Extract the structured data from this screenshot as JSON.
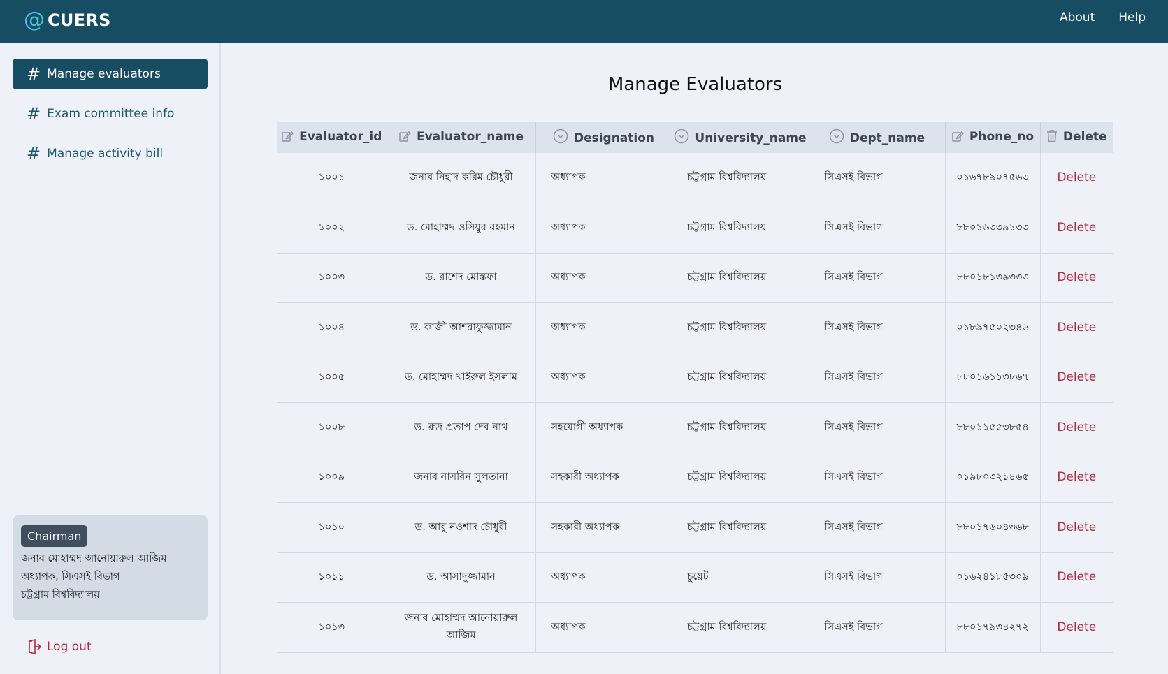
{
  "app": {
    "logo_symbol": "@",
    "name": "CUERS"
  },
  "topnav": {
    "about": "About",
    "help": "Help"
  },
  "sidebar": {
    "items": [
      {
        "label": "Manage evaluators",
        "active": true
      },
      {
        "label": "Exam committee info",
        "active": false
      },
      {
        "label": "Manage activity bill",
        "active": false
      }
    ]
  },
  "user": {
    "role": "Chairman",
    "name": "জনাব মোহাম্মদ আনোয়ারুল আজিম",
    "designation": "অধ্যাপক, সিএসই বিভাগ",
    "university": "চট্টগ্রাম বিশ্ববিদ্যালয়"
  },
  "logout_label": "Log out",
  "page": {
    "title": "Manage Evaluators"
  },
  "table": {
    "columns": [
      "Evaluator_id",
      "Evaluator_name",
      "Designation",
      "University_name",
      "Dept_name",
      "Phone_no",
      "Delete"
    ],
    "column_icons": [
      "edit-icon",
      "edit-icon",
      "chevron-down-circle-icon",
      "chevron-down-circle-icon",
      "chevron-down-circle-icon",
      "edit-icon",
      "trash-icon"
    ],
    "rows": [
      {
        "id": "১০০১",
        "name": "জনাব নিহাদ করিম চৌধুরী",
        "designation": "অধ্যাপক",
        "university": "চট্টগ্রাম বিশ্ববিদ্যালয়",
        "dept": "সিএসই বিভাগ",
        "phone": "০১৬৭৮৯০৭৫৬৩",
        "action": "Delete"
      },
      {
        "id": "১০০২",
        "name": "ড. মোহাম্মদ ওসিয়ুর রহমান",
        "designation": "অধ্যাপক",
        "university": "চট্টগ্রাম বিশ্ববিদ্যালয়",
        "dept": "সিএসই বিভাগ",
        "phone": "৮৮০১৬৩৩৯১৩৩",
        "action": "Delete"
      },
      {
        "id": "১০০৩",
        "name": "ড. রাশেদ মোস্তফা",
        "designation": "অধ্যাপক",
        "university": "চট্টগ্রাম বিশ্ববিদ্যালয়",
        "dept": "সিএসই বিভাগ",
        "phone": "৮৮০১৮১৩৯৩৩৩",
        "action": "Delete"
      },
      {
        "id": "১০০৪",
        "name": "ড. কাজী আশরাফুজ্জামান",
        "designation": "অধ্যাপক",
        "university": "চট্টগ্রাম বিশ্ববিদ্যালয়",
        "dept": "সিএসই বিভাগ",
        "phone": "০১৮৯৭৫০২৩৪৬",
        "action": "Delete"
      },
      {
        "id": "১০০৫",
        "name": "ড. মোহাম্মদ খাইরুল ইসলাম",
        "designation": "অধ্যাপক",
        "university": "চট্টগ্রাম বিশ্ববিদ্যালয়",
        "dept": "সিএসই বিভাগ",
        "phone": "৮৮০১৬১১৩৮৬৭",
        "action": "Delete"
      },
      {
        "id": "১০০৮",
        "name": "ড. রুদ্র প্রতাপ দেব নাথ",
        "designation": "সহযোগী অধ্যাপক",
        "university": "চট্টগ্রাম বিশ্ববিদ্যালয়",
        "dept": "সিএসই বিভাগ",
        "phone": "৮৮০১১৫৫৩৮৫৪",
        "action": "Delete"
      },
      {
        "id": "১০০৯",
        "name": "জনাব নাসরিন সুলতানা",
        "designation": "সহকারী অধ্যাপক",
        "university": "চট্টগ্রাম বিশ্ববিদ্যালয়",
        "dept": "সিএসই বিভাগ",
        "phone": "০১৯৮০৩২১৪৬৫",
        "action": "Delete"
      },
      {
        "id": "১০১০",
        "name": "ড. আবু নওশাদ চৌধুরী",
        "designation": "সহকারী অধ্যাপক",
        "university": "চট্টগ্রাম বিশ্ববিদ্যালয়",
        "dept": "সিএসই বিভাগ",
        "phone": "৮৮০১৭৬০৪৩৬৮",
        "action": "Delete"
      },
      {
        "id": "১০১১",
        "name": "ড. আসাদুজ্জামান",
        "designation": "অধ্যাপক",
        "university": "চুয়েট",
        "dept": "সিএসই বিভাগ",
        "phone": "০১৬২৪১৮৫৩০৯",
        "action": "Delete"
      },
      {
        "id": "১০১৩",
        "name": "জনাব মোহাম্মদ আনোয়ারুল আজিম",
        "designation": "অধ্যাপক",
        "university": "চট্টগ্রাম বিশ্ববিদ্যালয়",
        "dept": "সিএসই বিভাগ",
        "phone": "৮৮০১৭৯৩৪২৭২",
        "action": "Delete"
      }
    ]
  }
}
